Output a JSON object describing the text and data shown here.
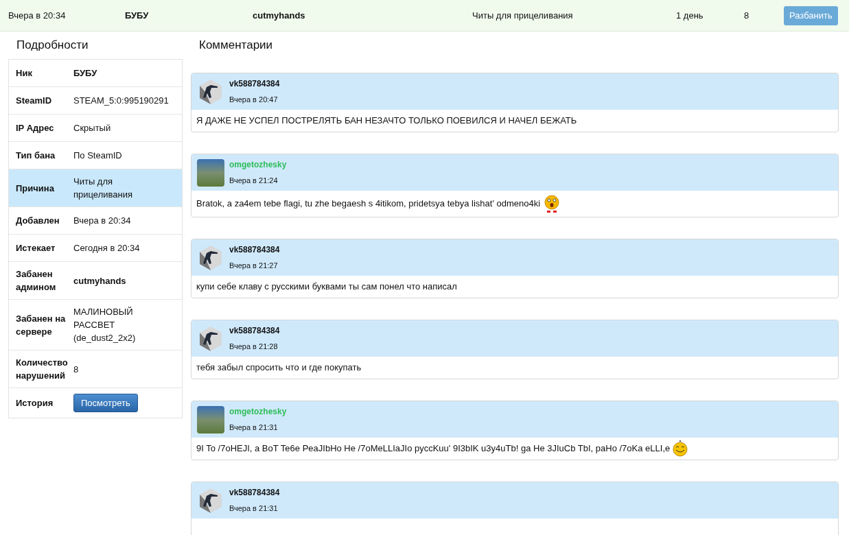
{
  "ban_row": {
    "date": "Вчера в 20:34",
    "nick": "БУБУ",
    "admin": "cutmyhands",
    "reason": "Читы для прицеливания",
    "duration": "1 день",
    "count": "8",
    "unban_button": "Разбанить"
  },
  "details": {
    "title": "Подробности",
    "rows": [
      {
        "label": "Ник",
        "value": "БУБУ",
        "kind": "bold",
        "selected": false
      },
      {
        "label": "SteamID",
        "value": "STEAM_5:0:995190291",
        "kind": "text",
        "selected": false
      },
      {
        "label": "IP Адрес",
        "value": "Скрытый",
        "kind": "text",
        "selected": false
      },
      {
        "label": "Тип бана",
        "value": "По SteamID",
        "kind": "text",
        "selected": false
      },
      {
        "label": "Причина",
        "value": "Читы для прицеливания",
        "kind": "text",
        "selected": true
      },
      {
        "label": "Добавлен",
        "value": "Вчера в 20:34",
        "kind": "text",
        "selected": false
      },
      {
        "label": "Истекает",
        "value": "Сегодня в 20:34",
        "kind": "text",
        "selected": false
      },
      {
        "label": "Забанен админом",
        "value": "cutmyhands",
        "kind": "bold",
        "selected": false
      },
      {
        "label": "Забанен на сервере",
        "value": "МАЛИНОВЫЙ РАССВЕТ (de_dust2_2x2)",
        "kind": "text",
        "selected": false
      },
      {
        "label": "Количество нарушений",
        "value": "8",
        "kind": "text",
        "selected": false
      },
      {
        "label": "История",
        "value": "Посмотреть",
        "kind": "button",
        "selected": false
      }
    ]
  },
  "comments": {
    "title": "Комментарии",
    "items": [
      {
        "author": "vk588784384",
        "color": "#111111",
        "avatar": {
          "kind": "soldier"
        },
        "time": "Вчера в 20:47",
        "text": "Я ДАЖЕ НЕ УСПЕЛ ПОСТРЕЛЯТЬ БАН НЕЗАЧТО ТОЛЬКО ПОЕВИЛСЯ И НАЧЕЛ БЕЖАТЬ"
      },
      {
        "author": "omgetozhesky",
        "color": "#2ebd59",
        "avatar": {
          "kind": "photo"
        },
        "time": "Вчера в 21:24",
        "text": "Bratok, a za4em tebe flagi, tu zhe begaesh s 4itikom, pridetsya tebya lishat' odmeno4ki",
        "emoji": {
          "kind": "scared"
        }
      },
      {
        "author": "vk588784384",
        "color": "#111111",
        "avatar": {
          "kind": "soldier"
        },
        "time": "Вчера в 21:27",
        "text": "купи себе клаву с русскими буквами ты сам понел что написал"
      },
      {
        "author": "vk588784384",
        "color": "#111111",
        "avatar": {
          "kind": "soldier"
        },
        "time": "Вчера в 21:28",
        "text": "тебя забыл спросить что и где покупать"
      },
      {
        "author": "omgetozhesky",
        "color": "#2ebd59",
        "avatar": {
          "kind": "photo"
        },
        "time": "Вчера в 21:31",
        "text": "9I To /7oHEJI, a BoT Te6e PeaJIbHo He /7oMeLLIaJIo pyccKuu' 9I3bIK u3y4uTb! ga He 3JIuCb TbI, paHo /7oKa eLLI,e",
        "emoji": {
          "kind": "grin"
        }
      },
      {
        "author": "vk588784384",
        "color": "#111111",
        "avatar": {
          "kind": "soldier"
        },
        "time": "Вчера в 21:31"
      }
    ]
  }
}
